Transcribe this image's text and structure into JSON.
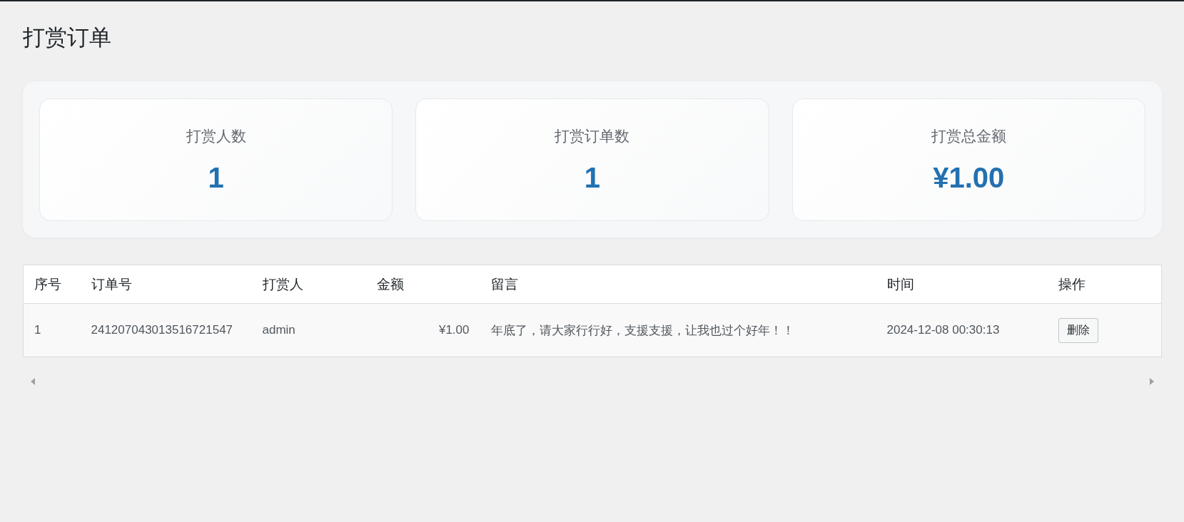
{
  "page": {
    "title": "打赏订单"
  },
  "stats": [
    {
      "label": "打赏人数",
      "value": "1"
    },
    {
      "label": "打赏订单数",
      "value": "1"
    },
    {
      "label": "打赏总金额",
      "value": "¥1.00"
    }
  ],
  "table": {
    "columns": [
      "序号",
      "订单号",
      "打赏人",
      "金额",
      "留言",
      "时间",
      "操作"
    ],
    "rows": [
      {
        "index": "1",
        "order_no": "241207043013516721547",
        "user": "admin",
        "amount": "¥1.00",
        "message": "年底了，请大家行行好，支援支援，让我也过个好年！！",
        "time": "2024-12-08 00:30:13",
        "action": "删除"
      }
    ]
  }
}
